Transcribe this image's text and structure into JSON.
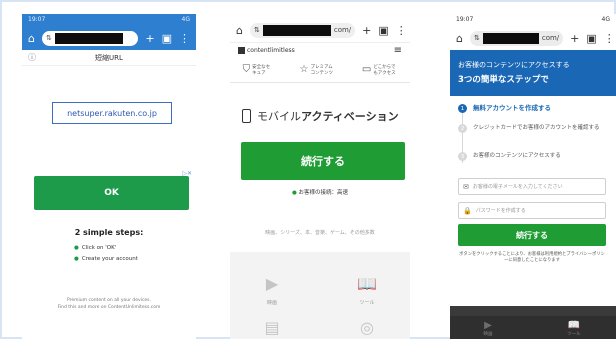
{
  "phone1": {
    "status": {
      "time": "19:07",
      "right": "4G"
    },
    "url": {
      "suffix": ""
    },
    "toolbar": {
      "home": "⌂",
      "tune": "⇅",
      "plus": "+",
      "tabs": "▣",
      "menu": "⋮"
    },
    "title": "短縮URL",
    "info": "ⓘ",
    "domain": "netsuper.rakuten.co.jp",
    "ad_tag": "▷✕",
    "ok_label": "OK",
    "steps_title": "2 simple steps:",
    "steps": [
      "Click on 'OK'",
      "Create your account"
    ],
    "footer": [
      "Premium content on all your devices.",
      "Find this and more on ContentUnlimitess.com"
    ]
  },
  "phone2": {
    "url": {
      "suffix": "com/"
    },
    "toolbar": {
      "home": "⌂",
      "tune": "⇅",
      "plus": "+",
      "tabs": "▣",
      "menu": "⋮"
    },
    "site_name": "contentlimitless",
    "hamburger": "≡",
    "features": [
      {
        "icon": "⛉",
        "label": "安全なセキュア"
      },
      {
        "icon": "☆",
        "label": "プレミアムコンテンツ"
      },
      {
        "icon": "▭",
        "label": "どこからでもアクセス"
      }
    ],
    "heading_prefix": "モバイル",
    "heading_bold": "アクティベーション",
    "continue_label": "続行する",
    "speed_text": "お客様の接続：高速",
    "genres": "映画、シリーズ、本、音楽、ゲーム、その他多数",
    "tiles": [
      {
        "icon": "▶",
        "label": "映画"
      },
      {
        "icon": "📖",
        "label": "ツール"
      },
      {
        "icon": "▤",
        "label": ""
      },
      {
        "icon": "◎",
        "label": ""
      }
    ]
  },
  "phone3": {
    "status": {
      "time": "19:07",
      "right": "4G"
    },
    "url": {
      "suffix": "com/"
    },
    "toolbar": {
      "home": "⌂",
      "tune": "⇅",
      "plus": "+",
      "tabs": "▣",
      "menu": "⋮"
    },
    "hero_line1": "お客様のコンテンツにアクセスする",
    "hero_line2": "3つの簡単なステップで",
    "steps": [
      {
        "num": "1",
        "label": "無料アカウントを作成する"
      },
      {
        "num": "2",
        "label": "クレジットカードでお客様のアカウントを確認する"
      },
      {
        "num": "3",
        "label": "お客様のコンテンツにアクセスする"
      }
    ],
    "email_placeholder": "お客様の電子メールを入力してください",
    "password_placeholder": "パスワードを作成する",
    "continue_label": "続行する",
    "terms": "ボタンをクリックすることにより、お客様は利用規約とプライバシーポリシーに同意したことになります",
    "bg_tiles": [
      {
        "icon": "▶",
        "label": "映画"
      },
      {
        "icon": "📖",
        "label": "ツール"
      }
    ]
  }
}
